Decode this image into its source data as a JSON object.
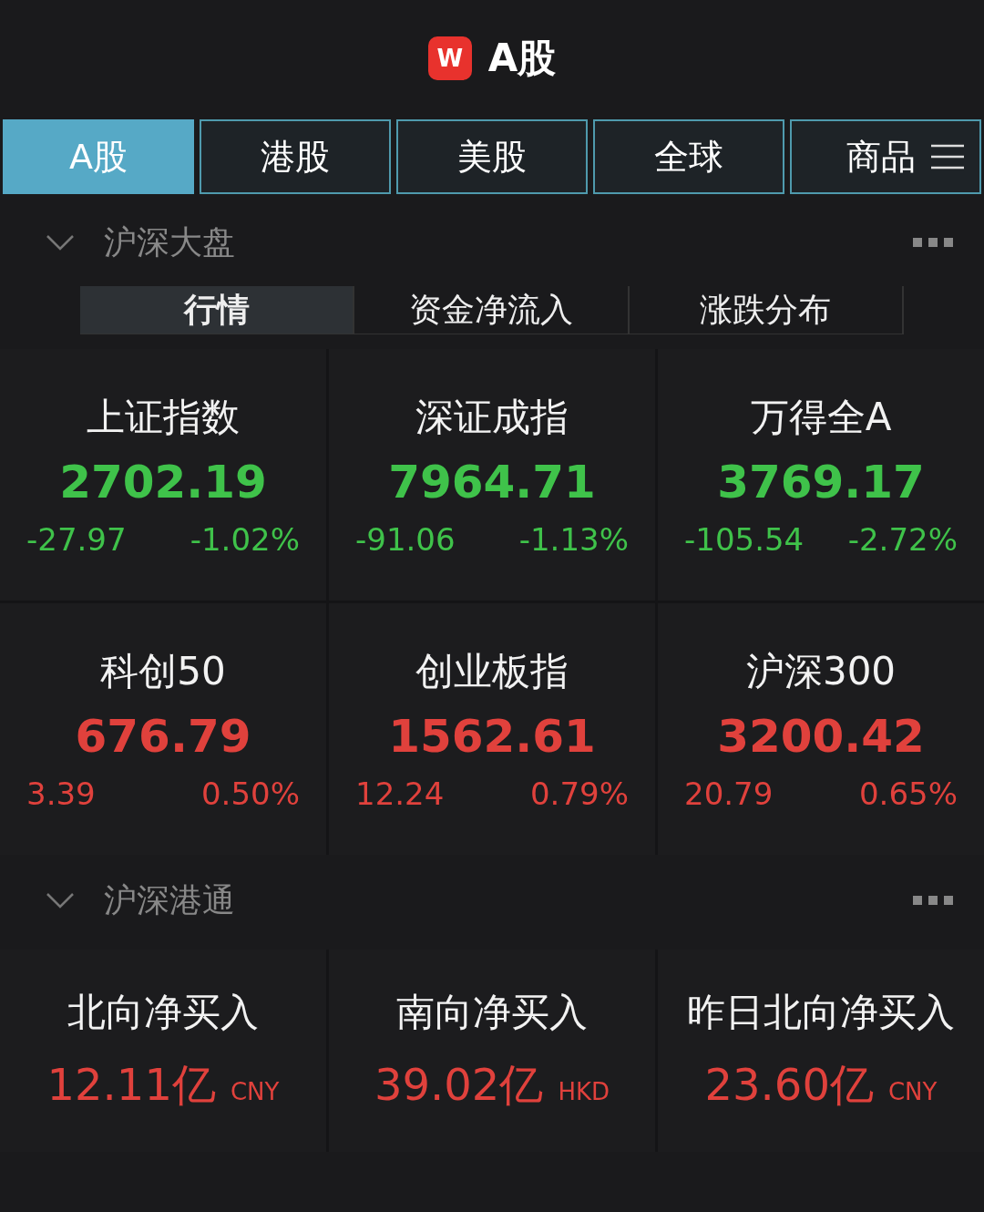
{
  "header": {
    "logo": "W",
    "title": "A股"
  },
  "tabs": [
    {
      "label": "A股",
      "selected": true
    },
    {
      "label": "港股",
      "selected": false
    },
    {
      "label": "美股",
      "selected": false
    },
    {
      "label": "全球",
      "selected": false
    },
    {
      "label": "商品",
      "selected": false
    }
  ],
  "sections": [
    {
      "title": "沪深大盘",
      "expanded": true,
      "subtabs": [
        {
          "label": "行情",
          "selected": true
        },
        {
          "label": "资金净流入",
          "selected": false
        },
        {
          "label": "涨跌分布",
          "selected": false
        }
      ],
      "indices": [
        {
          "name": "上证指数",
          "value": "2702.19",
          "change": "-27.97",
          "percent": "-1.02%",
          "color": "#3fc24a"
        },
        {
          "name": "深证成指",
          "value": "7964.71",
          "change": "-91.06",
          "percent": "-1.13%",
          "color": "#3fc24a"
        },
        {
          "name": "万得全A",
          "value": "3769.17",
          "change": "-105.54",
          "percent": "-2.72%",
          "color": "#3fc24a"
        },
        {
          "name": "科创50",
          "value": "676.79",
          "change": "3.39",
          "percent": "0.50%",
          "color": "#e0413c"
        },
        {
          "name": "创业板指",
          "value": "1562.61",
          "change": "12.24",
          "percent": "0.79%",
          "color": "#e0413c"
        },
        {
          "name": "沪深300",
          "value": "3200.42",
          "change": "20.79",
          "percent": "0.65%",
          "color": "#e0413c"
        }
      ]
    },
    {
      "title": "沪深港通",
      "expanded": true,
      "flows": [
        {
          "name": "北向净买入",
          "value": "12.11亿",
          "currency": "CNY",
          "color": "#e0413c"
        },
        {
          "name": "南向净买入",
          "value": "39.02亿",
          "currency": "HKD",
          "color": "#e0413c"
        },
        {
          "name": "昨日北向净买入",
          "value": "23.60亿",
          "currency": "CNY",
          "color": "#e0413c"
        }
      ]
    }
  ]
}
